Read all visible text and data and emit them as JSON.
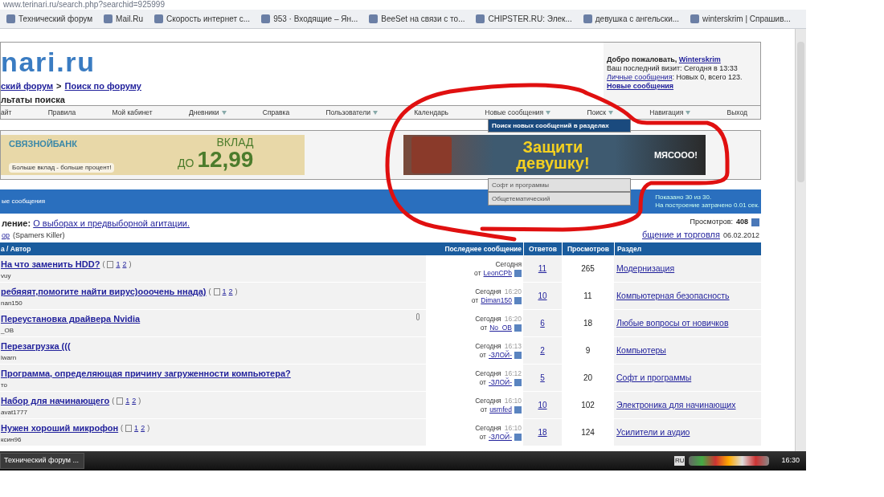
{
  "browser": {
    "url": "www.terinari.ru/search.php?searchid=925999",
    "bookmarks": [
      "Технический форум",
      "Mail.Ru",
      "Скорость интернет с...",
      "953 · Входящие – Ян...",
      "BeeSet на связи с то...",
      "CHIPSTER.RU: Элек...",
      "девушка с ангельски...",
      "winterskrim | Спрашив..."
    ]
  },
  "header": {
    "logo": "nari.ru",
    "breadcrumb": [
      "ский форум",
      "Поиск по форуму"
    ],
    "breadcrumb_separator": ">",
    "page_title": "льтаты поиска",
    "welcome": {
      "greeting": "Добро пожаловать,",
      "user": "Winterskrim",
      "last_visit": "Ваш последний визит: Сегодня в 13:33",
      "pm_link": "Личные сообщения",
      "pm_counts": ": Новых 0, всего 123.",
      "new_posts": "Новые сообщения"
    }
  },
  "nav": [
    {
      "label": "айт",
      "has_menu": false
    },
    {
      "label": "Правила",
      "has_menu": false
    },
    {
      "label": "Мой кабинет",
      "has_menu": false
    },
    {
      "label": "Дневники",
      "has_menu": true
    },
    {
      "label": "Справка",
      "has_menu": false
    },
    {
      "label": "Пользователи",
      "has_menu": true
    },
    {
      "label": "Календарь",
      "has_menu": false
    },
    {
      "label": "Новые сообщения",
      "has_menu": true
    },
    {
      "label": "Поиск",
      "has_menu": true
    },
    {
      "label": "Навигация",
      "has_menu": true
    },
    {
      "label": "Выход",
      "has_menu": false
    }
  ],
  "dropdown": [
    {
      "label": "Поиск новых сообщений в разделах",
      "selected": true
    },
    {
      "label": "Софт и программы",
      "selected": false
    },
    {
      "label": "Общетематический",
      "selected": false
    }
  ],
  "banners": {
    "left": {
      "brand": "СВЯЗНОЙБАНК",
      "offer": "ВКЛАД",
      "offer2": "ДО",
      "rate": "12,99",
      "slogan": "Больше вклад - больше процент!"
    },
    "right": {
      "headline": "Защити девушку!",
      "tag": "МЯСООО!"
    }
  },
  "results_bar": {
    "title": "ые сообщения",
    "shown": "Показано 30 из 30.",
    "time": "На построение затрачено 0.01 сек."
  },
  "sticky": {
    "prefix": "ление:",
    "title": "О выборах и предвыборной агитации.",
    "author": "ор",
    "author_note": "(Spamers Killer)",
    "views_label": "Просмотров:",
    "views": "408",
    "section": "бщение и торговля",
    "date": "06.02.2012"
  },
  "table": {
    "columns": [
      "а / Автор",
      "Последнее сообщение",
      "Ответов",
      "Просмотров",
      "Раздел"
    ],
    "rows": [
      {
        "title": "На что заменить HDD?",
        "pages": {
          "open": "(",
          "links": [
            "1",
            "2"
          ],
          "close": ")"
        },
        "attachment": false,
        "author": "vuy",
        "day": "Сегодня",
        "by_prefix": "от",
        "by": "LeonCPb",
        "replies": "11",
        "views": "265",
        "section": "Модернизация"
      },
      {
        "title": "ребяяят,помогите найти вирус)ооочень ннада)",
        "pages": {
          "open": "(",
          "links": [
            "1",
            "2"
          ],
          "close": ")"
        },
        "attachment": false,
        "author": "nan150",
        "day": "Сегодня",
        "time": "16:20",
        "by_prefix": "от",
        "by": "Diman150",
        "replies": "10",
        "views": "11",
        "section": "Компьютерная безопасность"
      },
      {
        "title": "Переустановка драйвера Nvidia",
        "attachment": true,
        "author": "_OB",
        "day": "Сегодня",
        "time": "16:20",
        "by_prefix": "от",
        "by": "No_OB",
        "replies": "6",
        "views": "18",
        "section": "Любые вопросы от новичков"
      },
      {
        "title": "Перезагрузка (((",
        "attachment": false,
        "author": "lwarn",
        "day": "Сегодня",
        "time": "16:13",
        "by_prefix": "от",
        "by": "-ЗЛОЙ-",
        "replies": "2",
        "views": "9",
        "section": "Компьютеры"
      },
      {
        "title": "Программа, определяющая причину загруженности компьютера?",
        "attachment": false,
        "author": "то",
        "day": "Сегодня",
        "time": "16:12",
        "by_prefix": "от",
        "by": "-ЗЛОЙ-",
        "replies": "5",
        "views": "20",
        "section": "Софт и программы"
      },
      {
        "title": "Набор для начинающего",
        "pages": {
          "open": "(",
          "links": [
            "1",
            "2"
          ],
          "close": ")"
        },
        "attachment": false,
        "author": "avat1777",
        "day": "Сегодня",
        "time": "16:10",
        "by_prefix": "от",
        "by": "usmfed",
        "replies": "10",
        "views": "102",
        "section": "Электроника для начинающих"
      },
      {
        "title": "Нужен хороший микрофон",
        "pages": {
          "open": "(",
          "links": [
            "1",
            "2"
          ],
          "close": ")"
        },
        "attachment": false,
        "author": "ксин96",
        "day": "Сегодня",
        "time": "16:10",
        "by_prefix": "от",
        "by": "-ЗЛОЙ-",
        "replies": "18",
        "views": "124",
        "section": "Усилители и аудио"
      }
    ]
  },
  "taskbar": {
    "window": "Технический форум ...",
    "lang": "RU",
    "clock": "16:30"
  }
}
